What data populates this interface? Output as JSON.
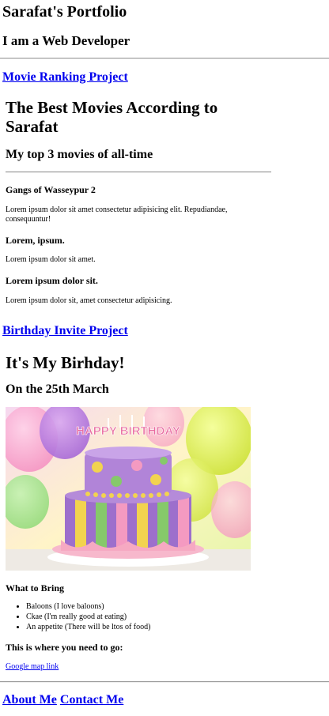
{
  "header": {
    "title": "Sarafat's Portfolio",
    "subtitle": "I am a Web Developer"
  },
  "movie_project": {
    "link_label": "Movie Ranking Project",
    "frame": {
      "heading": "The Best Movies According to Sarafat",
      "subheading": "My top 3 movies of all-time",
      "movies": [
        {
          "title": "Gangs of Wasseypur 2",
          "description": "Lorem ipsum dolor sit amet consectetur adipisicing elit. Repudiandae, consequuntur!"
        },
        {
          "title": "Lorem, ipsum.",
          "description": "Lorem ipsum dolor sit amet."
        },
        {
          "title": "Lorem ipsum dolor sit.",
          "description": "Lorem ipsum dolor sit, amet consectetur adipisicing."
        }
      ]
    }
  },
  "birthday_project": {
    "link_label": "Birthday Invite Project",
    "frame": {
      "heading": "It's My Birhday!",
      "date": "On the 25th March",
      "cake_text": "HAPPY BIRTHDAY",
      "bring_heading": "What to Bring",
      "bring_items": [
        "Baloons (I love baloons)",
        "Ckae (I'm really good at eating)",
        "An appetite (There will be ltos of food)"
      ],
      "location_heading": "This is where you need to go:",
      "map_link": "Google map link"
    }
  },
  "footer": {
    "about_label": "About Me",
    "contact_label": "Contact Me"
  }
}
